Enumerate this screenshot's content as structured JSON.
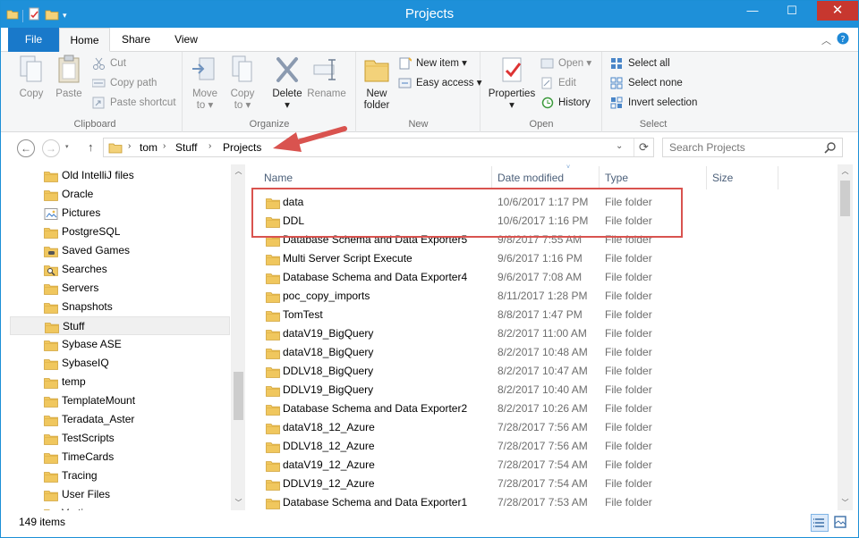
{
  "window": {
    "title": "Projects",
    "controls": {
      "minimize": "—",
      "maximize": "☐",
      "close": "✕"
    }
  },
  "ribbon": {
    "tabs": [
      "File",
      "Home",
      "Share",
      "View"
    ],
    "groups": {
      "clipboard": {
        "label": "Clipboard",
        "copy": "Copy",
        "paste": "Paste",
        "cut": "Cut",
        "copy_path": "Copy path",
        "paste_shortcut": "Paste shortcut"
      },
      "organize": {
        "label": "Organize",
        "move_to": "Move",
        "move_to_2": "to",
        "copy_to": "Copy",
        "copy_to_2": "to",
        "delete": "Delete",
        "rename": "Rename"
      },
      "new": {
        "label": "New",
        "new_folder": "New",
        "new_folder_2": "folder",
        "new_item": "New item",
        "easy_access": "Easy access"
      },
      "open": {
        "label": "Open",
        "properties": "Properties",
        "open": "Open",
        "edit": "Edit",
        "history": "History"
      },
      "select": {
        "label": "Select",
        "select_all": "Select all",
        "select_none": "Select none",
        "invert_selection": "Invert selection"
      }
    }
  },
  "address": {
    "crumbs": [
      "tom",
      "Stuff",
      "Projects"
    ],
    "search_placeholder": "Search Projects"
  },
  "nav_pane": {
    "items": [
      {
        "label": "Old IntelliJ files",
        "icon": "folder-icon"
      },
      {
        "label": "Oracle",
        "icon": "folder-icon"
      },
      {
        "label": "Pictures",
        "icon": "pictures-icon"
      },
      {
        "label": "PostgreSQL",
        "icon": "folder-icon"
      },
      {
        "label": "Saved Games",
        "icon": "saved-games-icon"
      },
      {
        "label": "Searches",
        "icon": "searches-icon"
      },
      {
        "label": "Servers",
        "icon": "folder-icon"
      },
      {
        "label": "Snapshots",
        "icon": "folder-icon"
      },
      {
        "label": "Stuff",
        "icon": "folder-icon",
        "selected": true
      },
      {
        "label": "Sybase ASE",
        "icon": "folder-icon"
      },
      {
        "label": "SybaseIQ",
        "icon": "folder-icon"
      },
      {
        "label": "temp",
        "icon": "folder-icon"
      },
      {
        "label": "TemplateMount",
        "icon": "folder-icon"
      },
      {
        "label": "Teradata_Aster",
        "icon": "folder-icon"
      },
      {
        "label": "TestScripts",
        "icon": "folder-icon"
      },
      {
        "label": "TimeCards",
        "icon": "folder-icon"
      },
      {
        "label": "Tracing",
        "icon": "folder-icon"
      },
      {
        "label": "User Files",
        "icon": "folder-icon"
      },
      {
        "label": "Vertica",
        "icon": "folder-icon"
      }
    ]
  },
  "file_list": {
    "columns": [
      "Name",
      "Date modified",
      "Type",
      "Size"
    ],
    "rows": [
      {
        "name": "data",
        "date": "10/6/2017 1:17 PM",
        "type": "File folder"
      },
      {
        "name": "DDL",
        "date": "10/6/2017 1:16 PM",
        "type": "File folder"
      },
      {
        "name": "Database Schema and Data Exporter5",
        "date": "9/8/2017 7:55 AM",
        "type": "File folder"
      },
      {
        "name": "Multi Server Script Execute",
        "date": "9/6/2017 1:16 PM",
        "type": "File folder"
      },
      {
        "name": "Database Schema and Data Exporter4",
        "date": "9/6/2017 7:08 AM",
        "type": "File folder"
      },
      {
        "name": "poc_copy_imports",
        "date": "8/11/2017 1:28 PM",
        "type": "File folder"
      },
      {
        "name": "TomTest",
        "date": "8/8/2017 1:47 PM",
        "type": "File folder"
      },
      {
        "name": "dataV19_BigQuery",
        "date": "8/2/2017 11:00 AM",
        "type": "File folder"
      },
      {
        "name": "dataV18_BigQuery",
        "date": "8/2/2017 10:48 AM",
        "type": "File folder"
      },
      {
        "name": "DDLV18_BigQuery",
        "date": "8/2/2017 10:47 AM",
        "type": "File folder"
      },
      {
        "name": "DDLV19_BigQuery",
        "date": "8/2/2017 10:40 AM",
        "type": "File folder"
      },
      {
        "name": "Database Schema and Data Exporter2",
        "date": "8/2/2017 10:26 AM",
        "type": "File folder"
      },
      {
        "name": "dataV18_12_Azure",
        "date": "7/28/2017 7:56 AM",
        "type": "File folder"
      },
      {
        "name": "DDLV18_12_Azure",
        "date": "7/28/2017 7:56 AM",
        "type": "File folder"
      },
      {
        "name": "dataV19_12_Azure",
        "date": "7/28/2017 7:54 AM",
        "type": "File folder"
      },
      {
        "name": "DDLV19_12_Azure",
        "date": "7/28/2017 7:54 AM",
        "type": "File folder"
      },
      {
        "name": "Database Schema and Data Exporter1",
        "date": "7/28/2017 7:53 AM",
        "type": "File folder"
      }
    ]
  },
  "status": {
    "item_count": "149 items"
  },
  "colors": {
    "title_bar": "#1e90d9",
    "file_tab": "#1979ca",
    "close_button": "#c7372f",
    "folder": "#e8b84a",
    "annotation_red": "#d9534f"
  }
}
